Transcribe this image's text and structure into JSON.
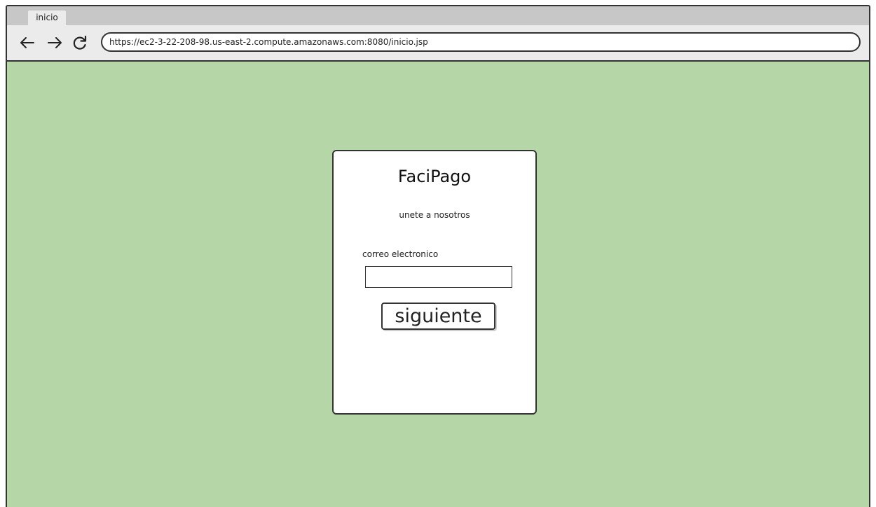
{
  "browser": {
    "tab_title": "inicio",
    "url": "https://ec2-3-22-208-98.us-east-2.compute.amazonaws.com:8080/inicio.jsp",
    "icons": [
      "back-arrow-icon",
      "forward-arrow-icon",
      "reload-icon"
    ]
  },
  "card": {
    "brand": "FaciPago",
    "subtitle": "unete a nosotros",
    "email_label": "correo electronico",
    "email_value": "",
    "next_label": "siguiente"
  },
  "colors": {
    "page_background": "#b5d6a7",
    "card_background": "#ffffff",
    "border": "#333333"
  }
}
